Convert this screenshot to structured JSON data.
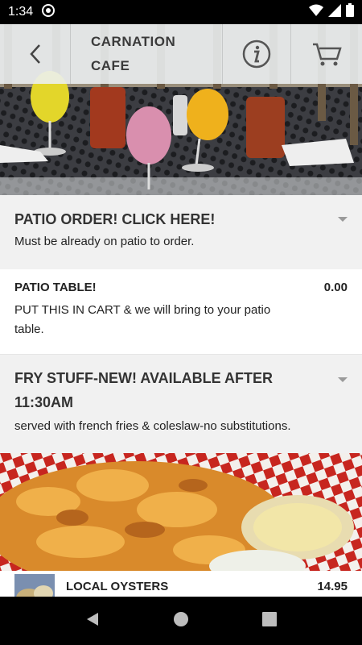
{
  "status_bar": {
    "time": "1:34"
  },
  "header": {
    "title_line1": "CARNATION",
    "title_line2": "CAFE"
  },
  "sections": [
    {
      "title": "PATIO ORDER! CLICK HERE!",
      "description": "Must be already on patio to order."
    },
    {
      "title_line1": "FRY STUFF-NEW! AVAILABLE AFTER",
      "title_line2": "11:30AM",
      "description": "served with french fries & coleslaw-no substitutions."
    }
  ],
  "items": [
    {
      "name": "PATIO TABLE!",
      "price": "0.00",
      "description_line1": "PUT THIS IN CART & we will bring to your patio",
      "description_line2": "table."
    },
    {
      "name": "LOCAL OYSTERS",
      "price": "14.95"
    }
  ],
  "colors": {
    "header_bg": "#ecf0f3",
    "section_bg": "#f1f1f1",
    "text_dark": "#333333",
    "caret": "#9a9a9a"
  }
}
